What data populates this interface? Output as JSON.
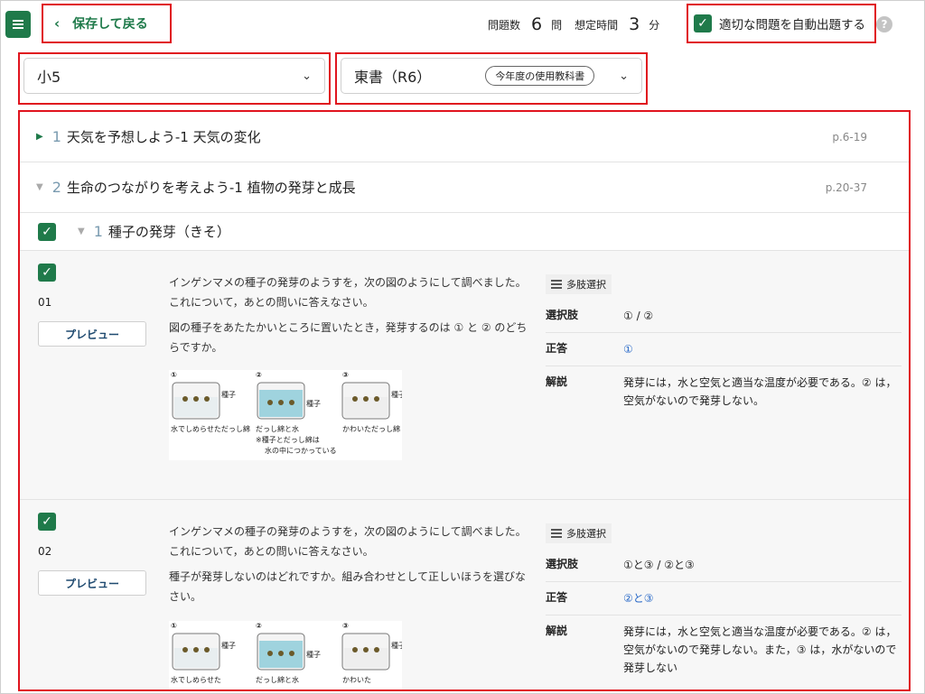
{
  "header": {
    "back_label": "保存して戻る",
    "question_count_label": "問題数",
    "question_count": "6",
    "question_unit": "問",
    "time_label": "想定時間",
    "time_value": "3",
    "time_unit": "分",
    "auto_label": "適切な問題を自動出題する",
    "help": "?"
  },
  "selects": {
    "grade": "小5",
    "textbook": "東書（R6）",
    "textbook_badge": "今年度の使用教科書"
  },
  "chapters": [
    {
      "num": "1",
      "title": "天気を予想しよう-1 天気の変化",
      "pages": "p.6-19"
    },
    {
      "num": "2",
      "title": "生命のつながりを考えよう-1 植物の発芽と成長",
      "pages": "p.20-37"
    }
  ],
  "section": {
    "num": "1",
    "title": "種子の発芽（きそ）"
  },
  "questions": [
    {
      "num": "01",
      "preview": "プレビュー",
      "text1": "インゲンマメの種子の発芽のようすを，次の図のようにして調べました。これについて，あとの問いに答えなさい。",
      "text2": "図の種子をあたたかいところに置いたとき，発芽するのは ① と ② のどちらですか。",
      "figure_labels": [
        "①",
        "②",
        "③",
        "種子",
        "種子",
        "種子",
        "水でしめらせただっし綿",
        "だっし綿と水",
        "※種子とだっし綿は",
        "水の中につかっている",
        "かわいただっし綿"
      ],
      "type_label": "多肢選択",
      "choices_label": "選択肢",
      "choices": "①  /  ②",
      "answer_label": "正答",
      "answer": "①",
      "explain_label": "解説",
      "explain": "発芽には，水と空気と適当な温度が必要である。② は，空気がないので発芽しない。"
    },
    {
      "num": "02",
      "preview": "プレビュー",
      "text1": "インゲンマメの種子の発芽のようすを，次の図のようにして調べました。これについて，あとの問いに答えなさい。",
      "text2": "種子が発芽しないのはどれですか。組み合わせとして正しいほうを選びなさい。",
      "figure_labels": [
        "①",
        "②",
        "③",
        "種子",
        "種子",
        "種子",
        "水でしめらせた",
        "だっし綿と水",
        "かわいた"
      ],
      "type_label": "多肢選択",
      "choices_label": "選択肢",
      "choices": "①と③  /  ②と③",
      "answer_label": "正答",
      "answer": "②と③",
      "explain_label": "解説",
      "explain": "発芽には，水と空気と適当な温度が必要である。② は，空気がないので発芽しない。また，③ は，水がないので発芽しない"
    }
  ],
  "colors": {
    "accent": "#1f7a4a",
    "highlight": "#e0141e",
    "link": "#2a6ac8"
  }
}
